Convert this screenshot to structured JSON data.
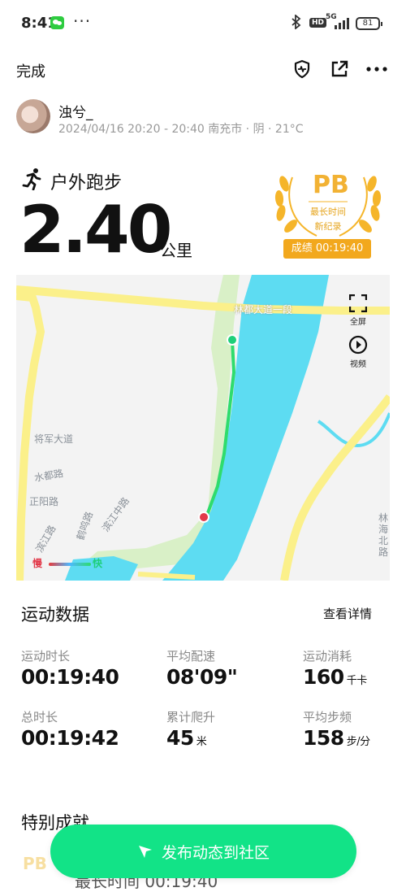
{
  "status_bar": {
    "time": "8:41",
    "dots": "···",
    "hd": "HD",
    "network": "5G",
    "battery": "81"
  },
  "nav": {
    "done_label": "完成"
  },
  "user": {
    "name": "浊兮_",
    "meta": "2024/04/16 20:20 - 20:40 南充市 · 阴 · 21°C"
  },
  "activity": {
    "type_label": "户外跑步",
    "distance": "2.40",
    "distance_unit": "公里"
  },
  "pb_badge": {
    "title": "PB",
    "line1": "最长时间",
    "line2": "新纪录",
    "score": "成绩 00:19:40"
  },
  "map": {
    "road_label_top": "林都大道一段",
    "road_label_1": "将军大道",
    "road_label_2": "水都路",
    "road_label_3": "正阳路",
    "road_label_4": "滨江路",
    "road_label_5": "鹤鸣路",
    "road_label_6": "滨江中路",
    "road_label_right": "林海北路",
    "fullscreen_label": "全屏",
    "video_label": "视频",
    "legend_slow": "慢",
    "legend_fast": "快"
  },
  "stats": {
    "title": "运动数据",
    "details_label": "查看详情",
    "items": [
      {
        "label": "运动时长",
        "value": "00:19:40",
        "unit": ""
      },
      {
        "label": "平均配速",
        "value": "08'09\"",
        "unit": ""
      },
      {
        "label": "运动消耗",
        "value": "160",
        "unit": "千卡"
      },
      {
        "label": "总时长",
        "value": "00:19:42",
        "unit": ""
      },
      {
        "label": "累计爬升",
        "value": "45",
        "unit": "米"
      },
      {
        "label": "平均步频",
        "value": "158",
        "unit": "步/分"
      }
    ]
  },
  "achievements": {
    "title": "特别成就",
    "badge": "PB",
    "text": "最长时间 00:19:40"
  },
  "publish_button": {
    "label": "发布动态到社区"
  },
  "colors": {
    "accent_green": "#12e387",
    "gold": "#f2a81d",
    "river": "#5ddcf2",
    "road": "#fbf08a"
  }
}
